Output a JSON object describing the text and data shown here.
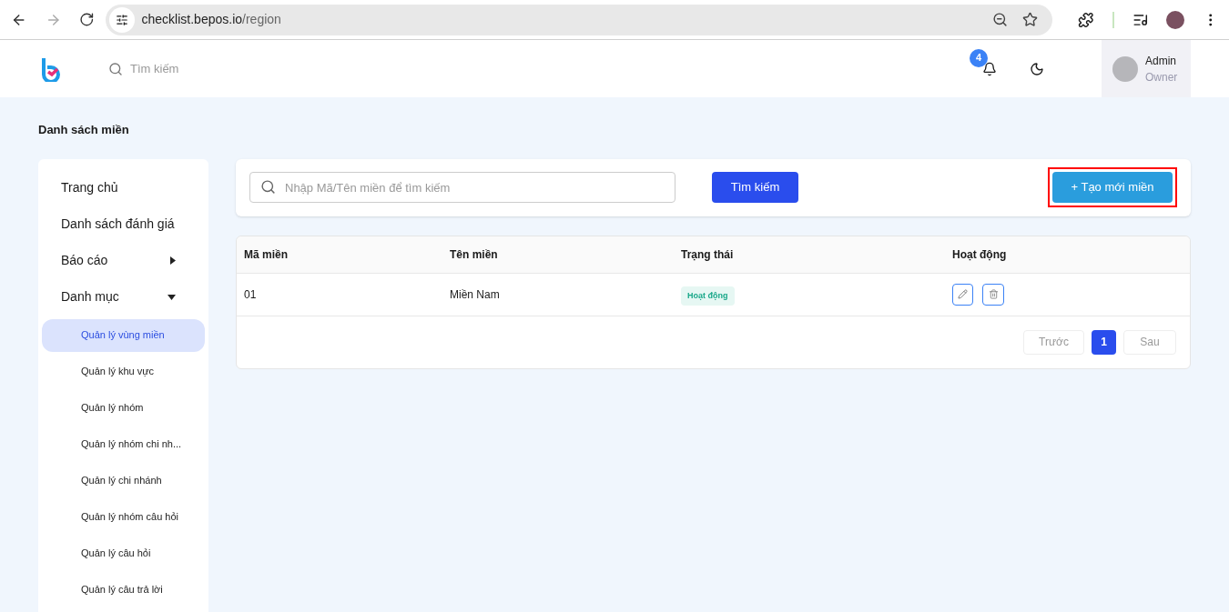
{
  "browser": {
    "url_host": "checklist.bepos.io",
    "url_path": "/region"
  },
  "header": {
    "search_placeholder": "Tìm kiếm",
    "notification_count": "4",
    "user": {
      "name": "Admin",
      "role": "Owner"
    }
  },
  "page_title": "Danh sách miền",
  "sidebar": {
    "items": [
      {
        "label": "Trang chủ",
        "kind": "link"
      },
      {
        "label": "Danh sách đánh giá",
        "kind": "link"
      },
      {
        "label": "Báo cáo",
        "kind": "group",
        "expanded": false
      },
      {
        "label": "Danh mục",
        "kind": "group",
        "expanded": true,
        "children": [
          {
            "label": "Quản lý vùng miền",
            "selected": true
          },
          {
            "label": "Quản lý khu vực",
            "selected": false
          },
          {
            "label": "Quản lý nhóm",
            "selected": false
          },
          {
            "label": "Quản lý nhóm chi nh...",
            "selected": false
          },
          {
            "label": "Quản lý chi nhánh",
            "selected": false
          },
          {
            "label": "Quản lý nhóm câu hỏi",
            "selected": false
          },
          {
            "label": "Quản lý câu hỏi",
            "selected": false
          },
          {
            "label": "Quản lý câu trả lời",
            "selected": false
          }
        ]
      }
    ]
  },
  "toolbar": {
    "search_placeholder": "Nhập Mã/Tên miền để tìm kiếm",
    "search_button": "Tìm kiếm",
    "create_button": {
      "label": "+ Tạo mới miền",
      "highlighted": true
    }
  },
  "table": {
    "columns": [
      "Mã miền",
      "Tên miền",
      "Trạng thái",
      "Hoạt động"
    ],
    "rows": [
      {
        "code": "01",
        "name": "Miền Nam",
        "status": "Hoạt động"
      }
    ]
  },
  "pagination": {
    "prev": "Trước",
    "pages": [
      {
        "label": "1",
        "selected": true
      }
    ],
    "next": "Sau"
  }
}
